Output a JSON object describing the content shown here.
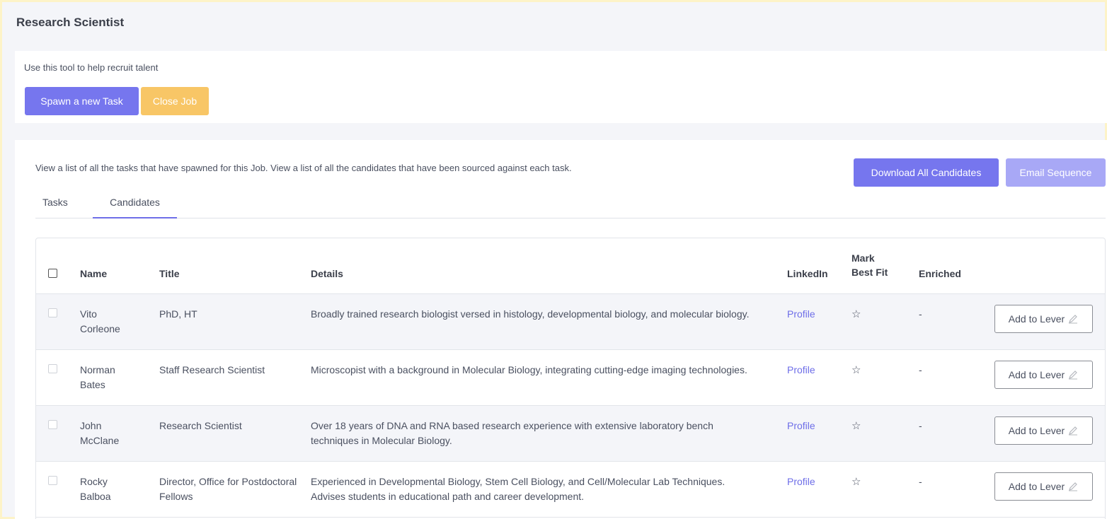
{
  "header": {
    "title": "Research Scientist"
  },
  "intro": {
    "text": "Use this tool to help recruit talent",
    "spawn_label": "Spawn a new Task",
    "close_label": "Close Job"
  },
  "main": {
    "description": "View a list of all the tasks that have spawned for this Job. View a list of all the candidates that have been sourced against each task.",
    "download_label": "Download All Candidates",
    "email_label": "Email Sequence",
    "tabs": [
      {
        "label": "Tasks",
        "active": false
      },
      {
        "label": "Candidates",
        "active": true
      }
    ]
  },
  "table": {
    "columns": {
      "name": "Name",
      "title": "Title",
      "details": "Details",
      "linkedin": "LinkedIn",
      "best_fit_line1": "Mark",
      "best_fit_line2": "Best Fit",
      "enriched": "Enriched"
    },
    "rows": [
      {
        "name_first": "Vito",
        "name_last": "Corleone",
        "title": "PhD, HT",
        "details": "Broadly trained research biologist versed in histology, developmental biology, and molecular biology.",
        "linkedin": "Profile",
        "enriched": "-",
        "action": "Add to Lever"
      },
      {
        "name_first": "Norman",
        "name_last": "Bates",
        "title": "Staff Research Scientist",
        "details": "Microscopist with a background in Molecular Biology, integrating cutting-edge imaging technologies.",
        "linkedin": "Profile",
        "enriched": "-",
        "action": "Add to Lever"
      },
      {
        "name_first": "John",
        "name_last": "McClane",
        "title": "Research Scientist",
        "details": "Over 18 years of DNA and RNA based research experience with extensive laboratory bench techniques in Molecular Biology.",
        "linkedin": "Profile",
        "enriched": "-",
        "action": "Add to Lever"
      },
      {
        "name_first": "Rocky",
        "name_last": "Balboa",
        "title": "Director, Office for Postdoctoral Fellows",
        "details": "Experienced in Developmental Biology, Stem Cell Biology, and Cell/Molecular Lab Techniques. Advises students in educational path and career development.",
        "linkedin": "Profile",
        "enriched": "-",
        "action": "Add to Lever"
      }
    ]
  },
  "icons": {
    "star": "star-outline-icon",
    "pencil": "pencil-icon"
  },
  "colors": {
    "primary": "#7676ee",
    "warning": "#f8c666",
    "primary_light": "#a8a8f6",
    "link": "#6e6ee8"
  }
}
